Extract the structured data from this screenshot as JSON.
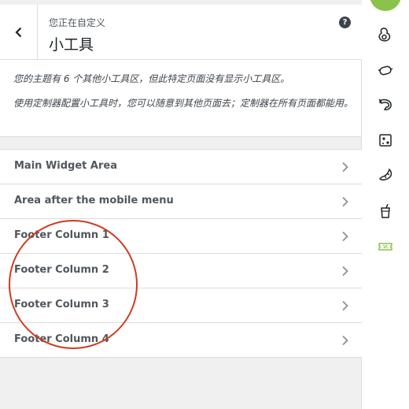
{
  "header": {
    "subtitle": "您正在自定义",
    "title": "小工具",
    "help_label": "?"
  },
  "notice": {
    "line1": "您的主题有 6 个其他小工具区，但此特定页面没有显示小工具区。",
    "line2": "使用定制器配置小工具时，您可以随意到其他页面去；定制器在所有页面都能用。"
  },
  "widget_areas": [
    {
      "label": "Main Widget Area"
    },
    {
      "label": "Area after the mobile menu"
    },
    {
      "label": "Footer Column 1"
    },
    {
      "label": "Footer Column 2"
    },
    {
      "label": "Footer Column 3"
    },
    {
      "label": "Footer Column 4"
    }
  ],
  "rail_icons": [
    "avocado-icon",
    "sausage-icon",
    "shrimp-icon",
    "cheese-icon",
    "croissant-icon",
    "drink-icon",
    "discount-ticket-icon"
  ],
  "colors": {
    "accent_green": "#8bc34a",
    "annotation_red": "#cf3a1e",
    "text_dark": "#1d2327"
  }
}
